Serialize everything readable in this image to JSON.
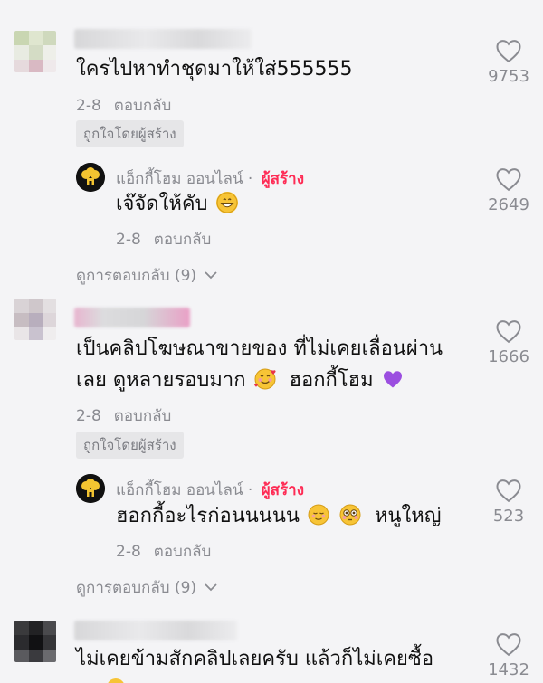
{
  "comments": [
    {
      "text": "ใครไปหาทำชุดมาให้ใส่555555",
      "date": "2-8",
      "reply_label": "ตอบกลับ",
      "badge": "ถูกใจโดยผู้สร้าง",
      "likes": "9753",
      "reply": {
        "author": "แอ็กกี้โฮม ออนไลน์",
        "creator_label": "ผู้สร้าง",
        "text": "เจ๊จัดให้คับ",
        "date": "2-8",
        "reply_label": "ตอบกลับ",
        "likes": "2649"
      },
      "view_replies": "ดูการตอบกลับ (9)"
    },
    {
      "text_line1": "เป็นคลิปโฆษณาขายของ ที่ไม่เคยเลื่อนผ่าน",
      "text_line2a": "เลย ดูหลายรอบมาก",
      "text_line2b": "ฮอกกี้โฮม",
      "date": "2-8",
      "reply_label": "ตอบกลับ",
      "badge": "ถูกใจโดยผู้สร้าง",
      "likes": "1666",
      "reply": {
        "author": "แอ็กกี้โฮม ออนไลน์",
        "creator_label": "ผู้สร้าง",
        "text_a": "ฮอกกี้อะไรก่อนนนนน",
        "text_b": "หนูใหญ่",
        "date": "2-8",
        "reply_label": "ตอบกลับ",
        "likes": "523"
      },
      "view_replies": "ดูการตอบกลับ (9)"
    },
    {
      "text": "ไม่เคยข้ามสักคลิปเลยครับ แล้วก็ไม่เคยซื้อ",
      "likes": "1432"
    }
  ]
}
